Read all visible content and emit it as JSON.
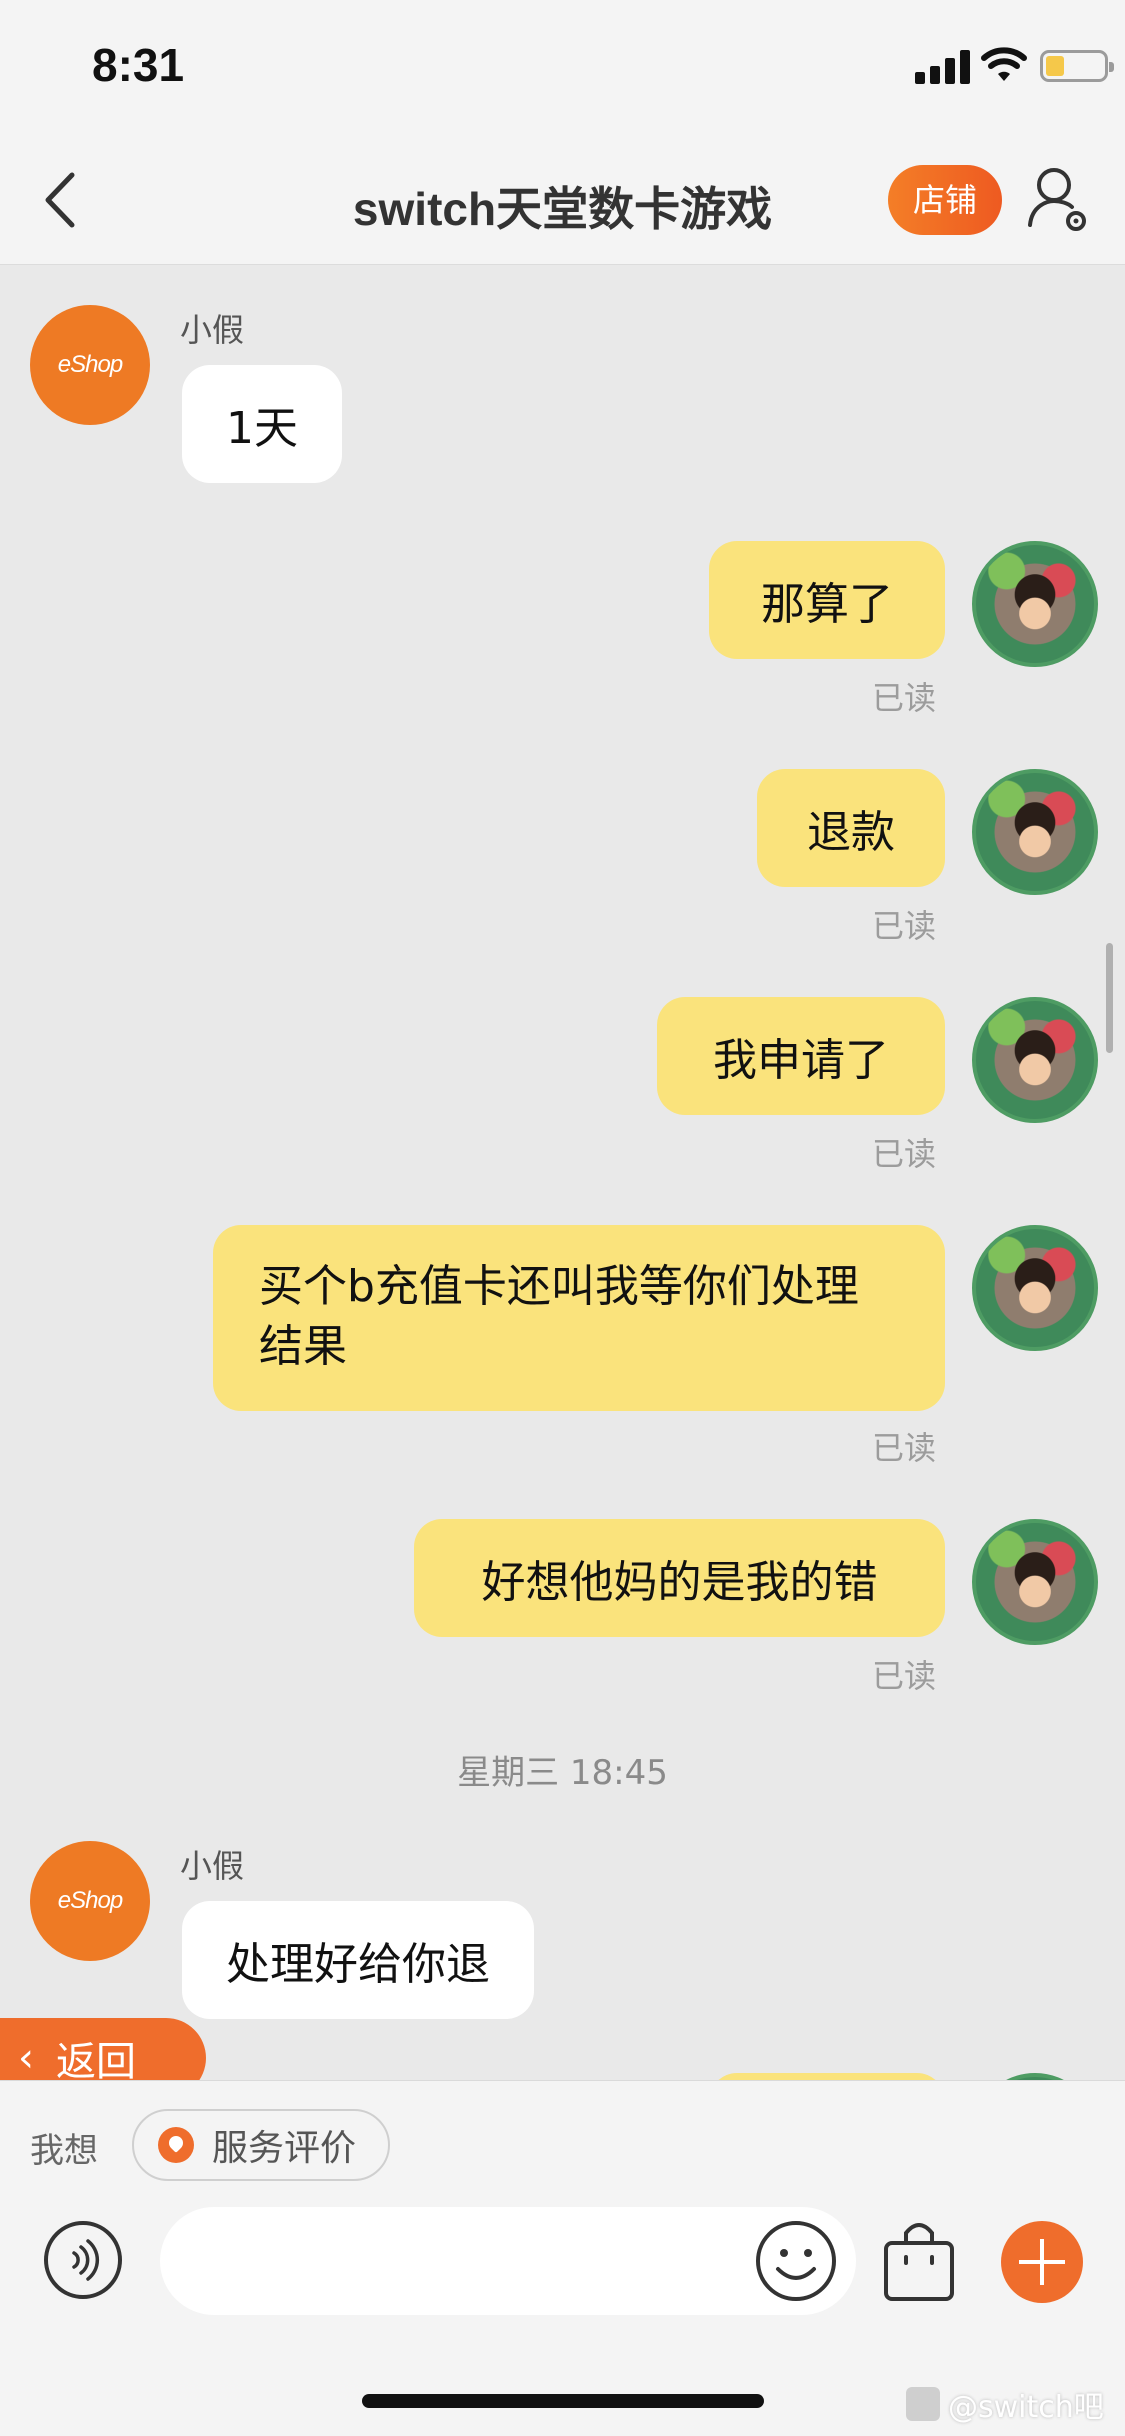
{
  "status_bar": {
    "time": "8:31"
  },
  "nav": {
    "title": "switch天堂数卡游戏",
    "shop_label": "店铺"
  },
  "chat": {
    "shop_avatar_text": "eShop",
    "messages": [
      {
        "from": "shop",
        "sender": "小假",
        "text": "1天"
      },
      {
        "from": "me",
        "text": "那算了",
        "status": "已读"
      },
      {
        "from": "me",
        "text": "退款",
        "status": "已读"
      },
      {
        "from": "me",
        "text": "我申请了",
        "status": "已读"
      },
      {
        "from": "me",
        "text": "买个b充值卡还叫我等你们处理结果",
        "status": "已读"
      },
      {
        "from": "me",
        "text": "好想他妈的是我的错",
        "status": "已读"
      },
      {
        "type": "time",
        "text": "星期三 18:45"
      },
      {
        "from": "shop",
        "sender": "小假",
        "text": "处理好给你退"
      }
    ]
  },
  "return_button": {
    "label": "返回"
  },
  "bottom": {
    "want_label": "我想",
    "service_label": "服务评价",
    "input_placeholder": ""
  },
  "watermark": {
    "text": "@switch吧"
  },
  "colors": {
    "accent": "#ef6d2c",
    "my_bubble": "#fae37c",
    "background": "#e9e9e9"
  }
}
